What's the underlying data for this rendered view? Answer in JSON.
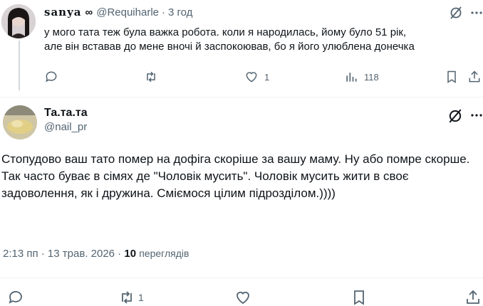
{
  "tweet1": {
    "display_name": "sanya",
    "name_emoji": "∞",
    "handle": "@Requiharle",
    "separator": "·",
    "time": "3 год",
    "text_line1": "у мого тата теж була важка робота. коли я народилась, йому було 51 рік,",
    "text_line2": "але він вставав до мене вночі й заспокоював, бо я його улюблена донечка",
    "likes": "1",
    "views": "118"
  },
  "tweet2": {
    "display_name": "Та.та.та",
    "handle": "@nail_pr",
    "text": "Стопудово ваш тато помер на дофіга скоріше за вашу маму. Ну або помре скорше. Так часто буває в сімях де \"Чоловік мусить\". Чоловік мусить жити в своє задоволення, як і дружина. Сміємося цілим підрозділом.))))",
    "timestamp": "2:13 пп · 13 трав. 2026 ·",
    "views_count": "10",
    "views_label": "переглядів",
    "retweets": "1"
  },
  "colors": {
    "text": "#0f1419",
    "muted": "#536471",
    "divider": "#eff3f4"
  }
}
